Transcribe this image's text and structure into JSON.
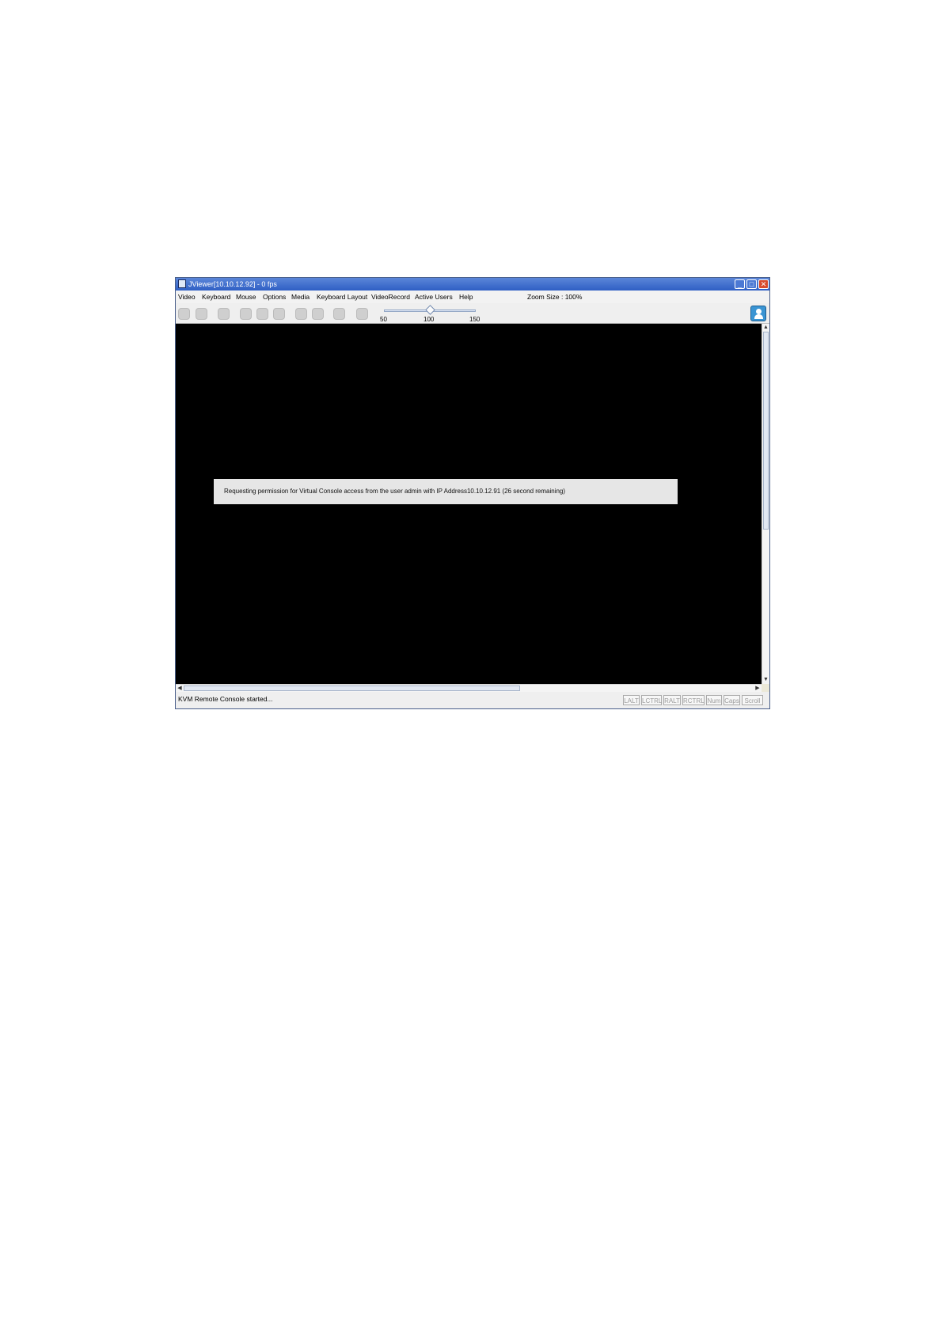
{
  "window": {
    "title": "JViewer[10.10.12.92] - 0 fps"
  },
  "menubar": {
    "items": [
      "Video",
      "Keyboard",
      "Mouse",
      "Options",
      "Media",
      "Keyboard Layout",
      "VideoRecord",
      "Active Users",
      "Help"
    ],
    "zoom_label": "Zoom Size : 100%"
  },
  "toolbar": {
    "slider": {
      "ticks": [
        "50",
        "100",
        "150"
      ],
      "value": 100
    }
  },
  "screen": {
    "message": "Requesting permission for Virtual Console access from the  user admin with IP Address10.10.12.91  (26 second remaining)"
  },
  "statusbar": {
    "text": "KVM Remote Console started...",
    "keys": [
      "LALT",
      "LCTRL",
      "RALT",
      "RCTRL",
      "Num",
      "Caps",
      "Scroll"
    ]
  },
  "colors": {
    "titlebar": "#2f5fc4",
    "screen_background": "#000000",
    "dialog_background": "#e6e6e6"
  }
}
